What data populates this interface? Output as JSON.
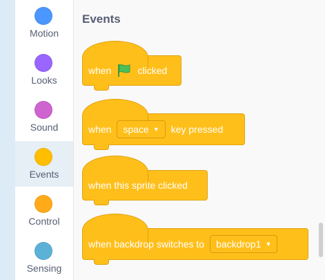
{
  "categories": [
    {
      "label": "Motion",
      "color": "#4c97ff"
    },
    {
      "label": "Looks",
      "color": "#9966ff"
    },
    {
      "label": "Sound",
      "color": "#cf63cf"
    },
    {
      "label": "Events",
      "color": "#ffbf00",
      "selected": true
    },
    {
      "label": "Control",
      "color": "#ffab19"
    },
    {
      "label": "Sensing",
      "color": "#5cb1d6"
    }
  ],
  "palette": {
    "title": "Events",
    "blocks": {
      "flag_clicked": {
        "before": "when",
        "after": "clicked",
        "icon": "green-flag-icon"
      },
      "key_pressed": {
        "before": "when",
        "key_value": "space",
        "after": "key pressed"
      },
      "sprite_clicked": {
        "text": "when this sprite clicked"
      },
      "backdrop_switch": {
        "before": "when backdrop switches to",
        "backdrop_value": "backdrop1"
      }
    }
  },
  "colors": {
    "events_block": "#ffbf1a",
    "flag_green": "#4cbf56"
  }
}
